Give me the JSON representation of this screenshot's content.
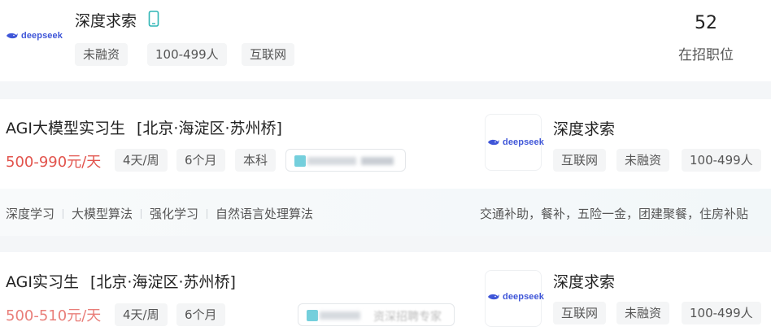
{
  "company_header": {
    "logo_text": "deepseek",
    "name": "深度求索",
    "tags": [
      "未融资",
      "100-499人",
      "互联网"
    ],
    "open_positions_count": "52",
    "open_positions_label": "在招职位"
  },
  "jobs": [
    {
      "title": "AGI大模型实习生",
      "location": "[北京·海淀区·苏州桥]",
      "salary": "500-990元/天",
      "tags": [
        "4天/周",
        "6个月",
        "本科"
      ],
      "company": {
        "logo_text": "deepseek",
        "name": "深度求索",
        "tags": [
          "互联网",
          "未融资",
          "100-499人"
        ]
      },
      "skills": [
        "深度学习",
        "大模型算法",
        "强化学习",
        "自然语言处理算法"
      ],
      "benefits": "交通补助，餐补，五险一金，团建聚餐，住房补贴"
    },
    {
      "title": "AGI实习生",
      "location": "[北京·海淀区·苏州桥]",
      "salary": "500-510元/天",
      "tags": [
        "4天/周",
        "6个月"
      ],
      "blurred_tag_text": "资深招聘专家",
      "company": {
        "logo_text": "deepseek",
        "name": "深度求索",
        "tags": [
          "互联网",
          "未融资",
          "100-499人"
        ]
      }
    }
  ],
  "colors": {
    "salary": "#e2544d",
    "logo_blue": "#3f56d8",
    "phone_icon": "#2fb5b5"
  }
}
